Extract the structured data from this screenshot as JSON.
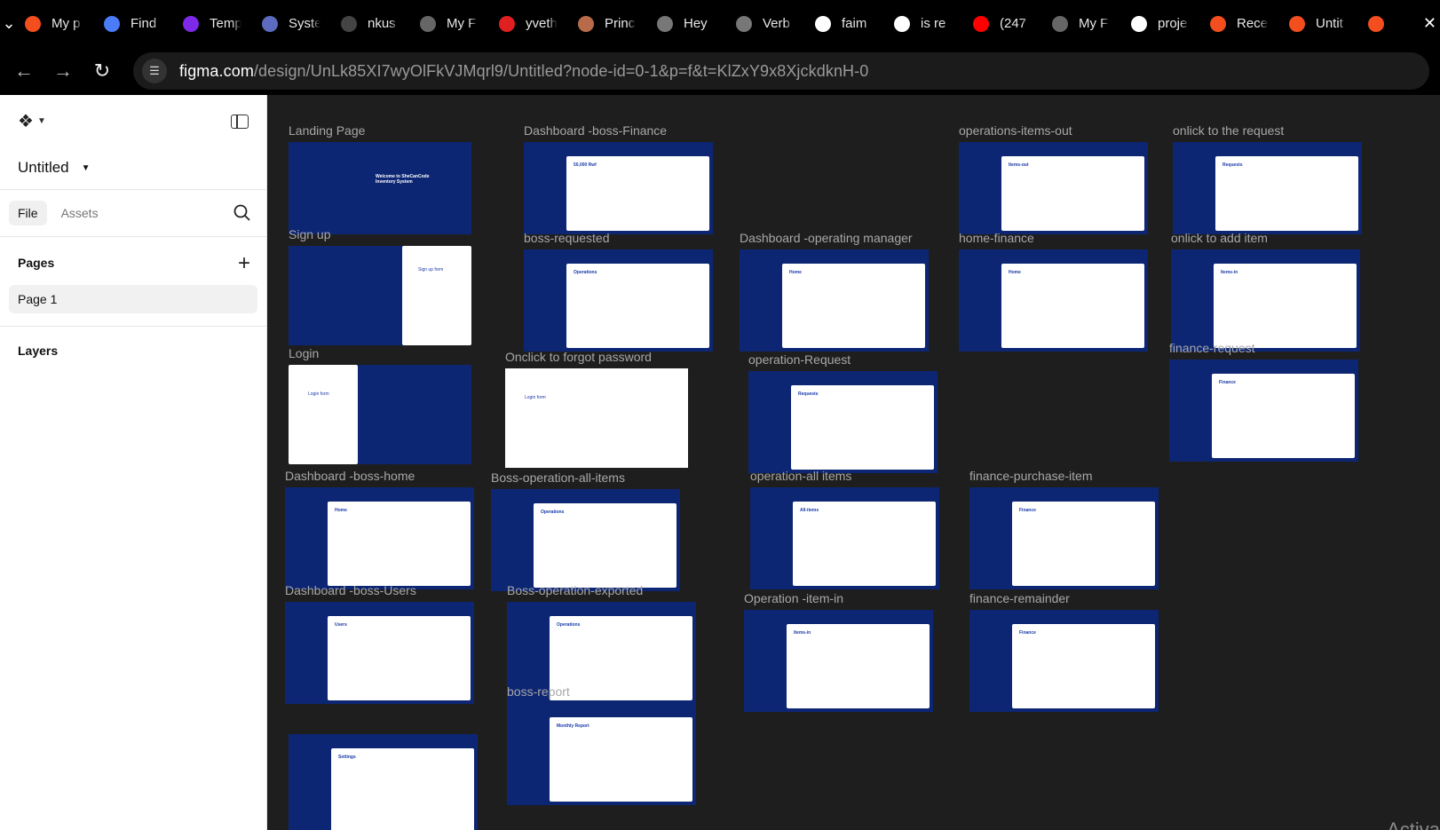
{
  "browser": {
    "tabs": [
      {
        "label": "My p",
        "icon": "figma-icon",
        "color": "#f24e1e"
      },
      {
        "label": "Find",
        "icon": "flag-icon",
        "color": "#4a7cf7"
      },
      {
        "label": "Temp",
        "icon": "canva-icon",
        "color": "#7d2ae8"
      },
      {
        "label": "Syste",
        "icon": "app-icon",
        "color": "#5c6bc0"
      },
      {
        "label": "nkus",
        "icon": "github-icon",
        "color": "#444444"
      },
      {
        "label": "My F",
        "icon": "chatgpt-icon",
        "color": "#666666"
      },
      {
        "label": "yveth",
        "icon": "pdf-icon",
        "color": "#e02020"
      },
      {
        "label": "Princ",
        "icon": "avatar-icon",
        "color": "#b86b4b"
      },
      {
        "label": "Hey",
        "icon": "chatgpt-icon",
        "color": "#777777"
      },
      {
        "label": "Verb",
        "icon": "chatgpt-icon",
        "color": "#777777"
      },
      {
        "label": "faim",
        "icon": "google-icon",
        "color": "#ffffff"
      },
      {
        "label": "is re",
        "icon": "google-icon",
        "color": "#ffffff"
      },
      {
        "label": "(247",
        "icon": "youtube-icon",
        "color": "#ff0000"
      },
      {
        "label": "My F",
        "icon": "chatgpt-icon",
        "color": "#666666"
      },
      {
        "label": "proje",
        "icon": "google-icon",
        "color": "#ffffff"
      },
      {
        "label": "Rece",
        "icon": "figma-icon",
        "color": "#f24e1e"
      },
      {
        "label": "Untit",
        "icon": "figma-icon",
        "color": "#f24e1e"
      },
      {
        "label": "",
        "icon": "figma-icon",
        "color": "#f24e1e"
      }
    ],
    "url_host": "figma.com",
    "url_path": "/design/UnLk85XI7wyOlFkVJMqrl9/Untitled?node-id=0-1&p=f&t=KlZxY9x8XjckdknH-0"
  },
  "sidebar": {
    "file_name": "Untitled",
    "tabs": [
      "File",
      "Assets"
    ],
    "pages_heading": "Pages",
    "pages": [
      "Page 1"
    ],
    "layers_heading": "Layers"
  },
  "frames": [
    {
      "label": "Landing Page",
      "mini": "Welcome to SheCanCode Inventory System"
    },
    {
      "label": "Dashboard -boss-Finance",
      "mini": "50,000 Rwf"
    },
    {
      "label": "operations-items-out",
      "mini": "Items-out"
    },
    {
      "label": "onlick to the request",
      "mini": "Requests"
    },
    {
      "label": "Sign up",
      "mini": "Sign up form"
    },
    {
      "label": "boss-requested",
      "mini": "Operations"
    },
    {
      "label": "Dashboard -operating manager",
      "mini": "Home"
    },
    {
      "label": "home-finance",
      "mini": "Home"
    },
    {
      "label": "onlick to add item",
      "mini": "Items-in"
    },
    {
      "label": "finance-request",
      "mini": "Finance"
    },
    {
      "label": "Login",
      "mini": "Login form"
    },
    {
      "label": "Onclick to forgot password",
      "mini": "Login form"
    },
    {
      "label": "operation-Request",
      "mini": "Requests"
    },
    {
      "label": "Dashboard -boss-home",
      "mini": "Home"
    },
    {
      "label": "Boss-operation-all-items",
      "mini": "Operations"
    },
    {
      "label": "operation-all items",
      "mini": "All-items"
    },
    {
      "label": "finance-purchase-item",
      "mini": "Finance"
    },
    {
      "label": "Dashboard -boss-Users",
      "mini": "Users"
    },
    {
      "label": "Boss-operation-exported",
      "mini": "Operations"
    },
    {
      "label": "Operation -item-in",
      "mini": "Items-in"
    },
    {
      "label": "finance-remainder",
      "mini": "Finance"
    },
    {
      "label": "boss-report",
      "mini": "Monthly Report"
    },
    {
      "label": "",
      "mini": "Settings"
    }
  ],
  "watermark": "Activa"
}
